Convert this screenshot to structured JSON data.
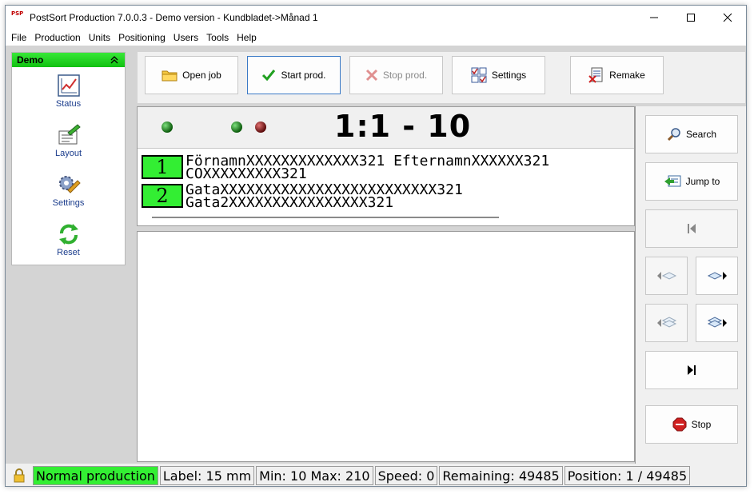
{
  "window": {
    "title": "PostSort Production 7.0.0.3  -  Demo version  -  Kundbladet->Månad 1",
    "app_icon_text": "PSP"
  },
  "menu": [
    "File",
    "Production",
    "Units",
    "Positioning",
    "Users",
    "Tools",
    "Help"
  ],
  "sidebar": {
    "header": "Demo",
    "items": [
      {
        "label": "Status",
        "icon": "chart-icon"
      },
      {
        "label": "Layout",
        "icon": "layout-edit-icon"
      },
      {
        "label": "Settings",
        "icon": "gear-wrench-icon"
      },
      {
        "label": "Reset",
        "icon": "refresh-icon"
      }
    ]
  },
  "toolbar": {
    "open_job": "Open job",
    "start_prod": "Start prod.",
    "stop_prod": "Stop prod.",
    "settings": "Settings",
    "remake": "Remake"
  },
  "display": {
    "counter": "1:1 - 10",
    "line1_number": "1",
    "line1_text_a": "FörnamnXXXXXXXXXXXXX321 EfternamnXXXXXX321",
    "line1_text_b": "COXXXXXXXXX321",
    "line2_number": "2",
    "line2_text_a": "GataXXXXXXXXXXXXXXXXXXXXXXXXX321",
    "line2_text_b": "Gata2XXXXXXXXXXXXXXXX321"
  },
  "right_panel": {
    "search": "Search",
    "jump_to": "Jump to",
    "stop": "Stop"
  },
  "status": {
    "mode": "Normal production",
    "label": "Label: 15 mm",
    "minmax": "Min: 10  Max: 210",
    "speed": "Speed: 0",
    "remaining": "Remaining: 49485",
    "position": "Position: 1 / 49485"
  },
  "colors": {
    "accent_green": "#33ee33",
    "link_blue": "#1a3c8c",
    "active_border": "#3a79c6"
  }
}
